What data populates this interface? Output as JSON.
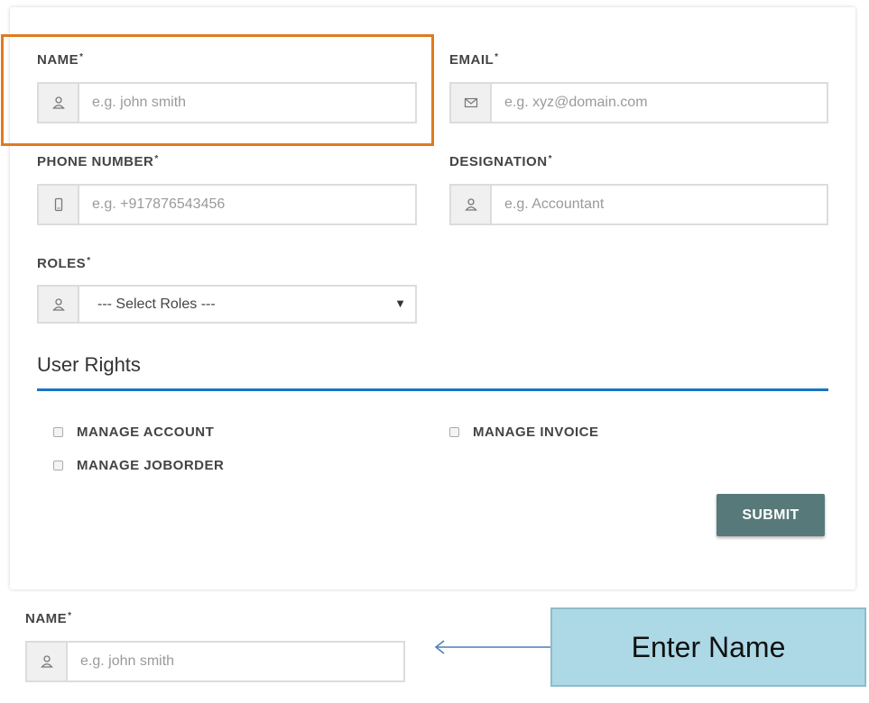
{
  "form": {
    "name": {
      "label": "NAME",
      "req": "*",
      "placeholder": "e.g. john smith",
      "icon": "user-icon"
    },
    "email": {
      "label": "EMAIL",
      "req": "*",
      "placeholder": "e.g. xyz@domain.com",
      "icon": "envelope-icon"
    },
    "phone": {
      "label": "PHONE NUMBER",
      "req": "*",
      "placeholder": "e.g. +917876543456",
      "icon": "mobile-icon"
    },
    "designation": {
      "label": "DESIGNATION",
      "req": "*",
      "placeholder": "e.g. Accountant",
      "icon": "user-icon"
    },
    "roles": {
      "label": "ROLES",
      "req": "*",
      "selected": "--- Select Roles ---",
      "icon": "user-icon"
    }
  },
  "user_rights": {
    "title": "User Rights",
    "items": [
      {
        "label": "MANAGE ACCOUNT",
        "checked": false
      },
      {
        "label": "MANAGE INVOICE",
        "checked": false
      },
      {
        "label": "MANAGE JOBORDER",
        "checked": false
      }
    ]
  },
  "submit_label": "SUBMIT",
  "zoom": {
    "label": "NAME",
    "req": "*",
    "placeholder": "e.g. john smith"
  },
  "callout": {
    "text": "Enter Name"
  },
  "colors": {
    "accent_rule": "#1a73c6",
    "submit_bg": "#577979",
    "highlight": "#e07a1f",
    "callout_bg": "#add8e6"
  }
}
